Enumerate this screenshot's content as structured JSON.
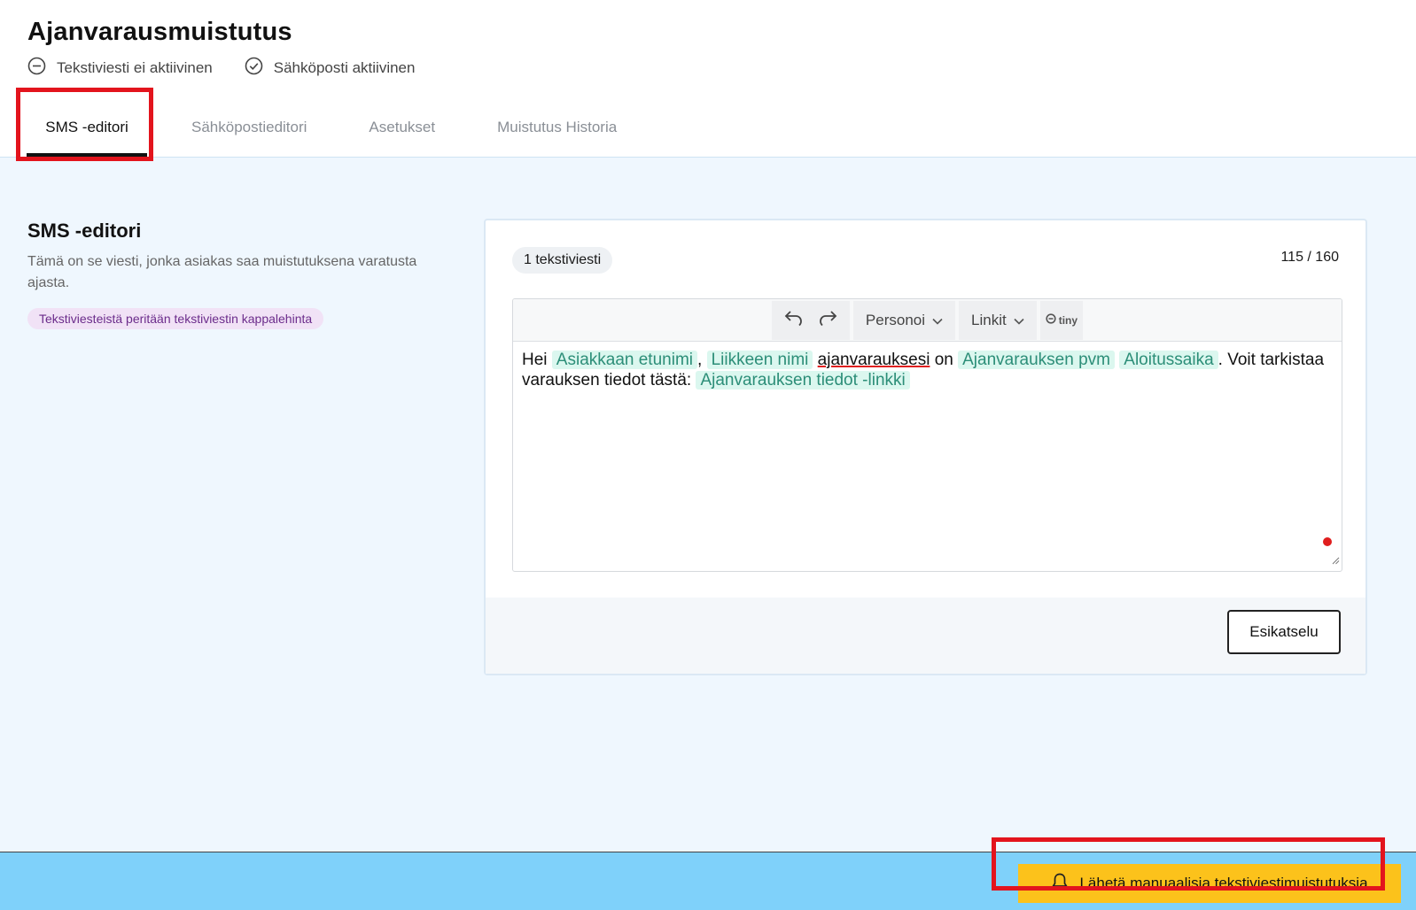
{
  "header": {
    "title": "Ajanvarausmuistutus",
    "statuses": [
      {
        "label": "Tekstiviesti ei aktiivinen",
        "icon": "minus-circle-icon"
      },
      {
        "label": "Sähköposti aktiivinen",
        "icon": "check-circle-icon"
      }
    ],
    "tabs": [
      {
        "label": "SMS -editori",
        "active": true
      },
      {
        "label": "Sähköpostieditori",
        "active": false
      },
      {
        "label": "Asetukset",
        "active": false
      },
      {
        "label": "Muistutus Historia",
        "active": false
      }
    ]
  },
  "section": {
    "title": "SMS -editori",
    "description": "Tämä on se viesti, jonka asiakas saa muistutuksena varatusta ajasta.",
    "price_note": "Tekstiviesteistä peritään tekstiviestin kappalehinta"
  },
  "editor": {
    "sms_count": "1 tekstiviesti",
    "char_count": "115 / 160",
    "toolbar": {
      "undo_icon": "undo-icon",
      "redo_icon": "redo-icon",
      "personalize_label": "Personoi",
      "links_label": "Linkit",
      "brand_label": "tiny"
    },
    "content": {
      "greeting": "Hei",
      "tag_first_name": "Asiakkaan etunimi",
      "comma": ",",
      "tag_business_name": "Liikkeen nimi",
      "word_booking": "ajanvarauksesi",
      "word_on": "on",
      "tag_booking_date": "Ajanvarauksen pvm",
      "tag_start_time": "Aloitussaika",
      "text_check": ". Voit tarkistaa varauksen tiedot tästä:",
      "tag_details_link": "Ajanvarauksen tiedot -linkki"
    },
    "preview_label": "Esikatselu"
  },
  "bottom_bar": {
    "send_label": "Lähetä manuaalisia tekstiviestimuistutuksia",
    "icon": "bell-icon"
  },
  "colors": {
    "main_background": "#eff7fe",
    "tag_background": "#dbf7ef",
    "tag_text": "#2c8e78",
    "badge_background": "#f1e2f6",
    "badge_text": "#6b2c8b",
    "bottom_bar": "#7fd1fa",
    "send_button": "#fcc21b",
    "highlight": "#e3141d"
  }
}
